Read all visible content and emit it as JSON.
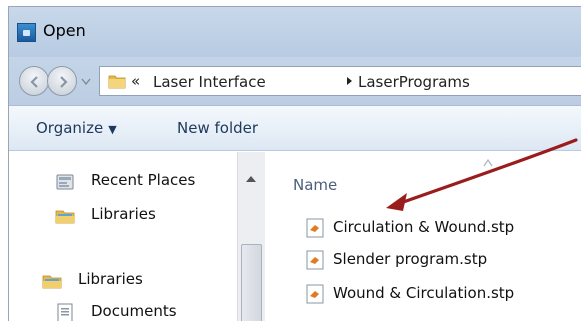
{
  "window": {
    "title": "Open"
  },
  "address_bar": {
    "overflow_chevron": "«",
    "breadcrumbs": [
      "Laser Interface",
      "LaserPrograms"
    ]
  },
  "command_bar": {
    "organize_label": "Organize",
    "new_folder_label": "New folder"
  },
  "nav_pane": {
    "items": [
      {
        "label": "Recent Places",
        "icon": "recent-places-icon"
      },
      {
        "label": "Libraries",
        "icon": "libraries-folder-icon"
      },
      {
        "label": "Libraries",
        "icon": "libraries-folder-icon"
      },
      {
        "label": "Documents",
        "icon": "documents-icon"
      }
    ]
  },
  "file_list": {
    "column_header": "Name",
    "files": [
      {
        "name": "Circulation & Wound.stp",
        "icon": "stp-file-icon"
      },
      {
        "name": "Slender program.stp",
        "icon": "stp-file-icon"
      },
      {
        "name": "Wound  &  Circulation.stp",
        "icon": "stp-file-icon"
      }
    ]
  },
  "annotation": {
    "arrow_color": "#9b1c1c"
  },
  "colors": {
    "titlebar": "#c3d4e8",
    "command_text": "#1e395b",
    "header_text": "#4c607a"
  }
}
